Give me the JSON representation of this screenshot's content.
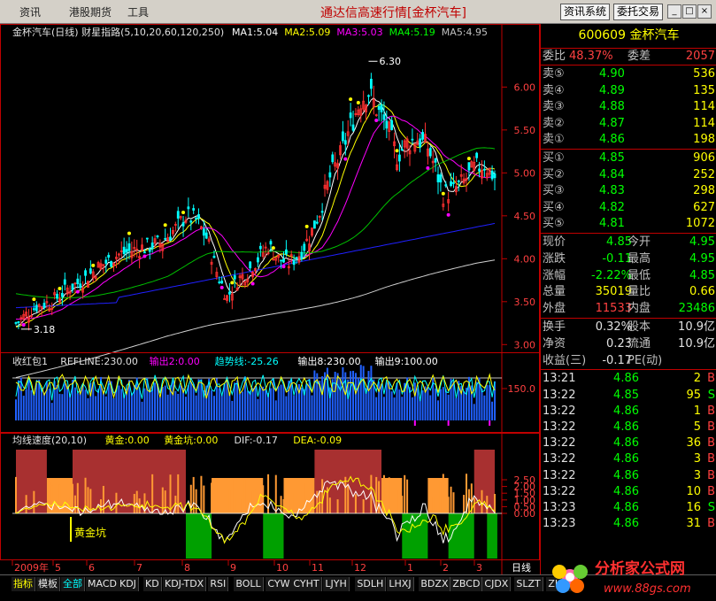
{
  "window": {
    "menus": [
      "资讯",
      "港股期货",
      "工具"
    ],
    "app_title": "通达信高速行情[金杯汽车]",
    "buttons": [
      "资讯系统",
      "委托交易"
    ],
    "win_controls": [
      "_",
      "□",
      "×"
    ]
  },
  "main_chart": {
    "header_prefix": "金杯汽车(日线) 财星指路(5,10,20,60,120,250)",
    "ma": [
      {
        "label": "MA1:5.04",
        "color": "#ffffff"
      },
      {
        "label": "MA2:5.09",
        "color": "#ffff00"
      },
      {
        "label": "MA3:5.03",
        "color": "#ff00ff"
      },
      {
        "label": "MA4:5.19",
        "color": "#00ff00"
      },
      {
        "label": "MA5:4.95",
        "color": "#c0c0c0"
      }
    ],
    "y_ticks": [
      "6.00",
      "5.50",
      "5.00",
      "4.50",
      "4.00",
      "3.50",
      "3.00"
    ],
    "high_label": "6.30",
    "low_label": "3.18"
  },
  "indicator1": {
    "items": [
      {
        "text": "收红包1",
        "color": "#e0e0e0"
      },
      {
        "text": "REFLINE:230.00",
        "color": "#e0e0e0"
      },
      {
        "text": "输出2:0.00",
        "color": "#ff00ff"
      },
      {
        "text": "趋势线:-25.26",
        "color": "#00ffff"
      },
      {
        "text": "输出8:230.00",
        "color": "#ffffff"
      },
      {
        "text": "输出9:100.00",
        "color": "#ffffff"
      }
    ],
    "y_tick": "150.0"
  },
  "indicator2": {
    "items": [
      {
        "text": "均线速度(20,10)",
        "color": "#e0e0e0"
      },
      {
        "text": "黄金:0.00",
        "color": "#ffff00"
      },
      {
        "text": "黄金坑:0.00",
        "color": "#ffff00"
      },
      {
        "text": "DIF:-0.17",
        "color": "#e0e0e0"
      },
      {
        "text": "DEA:-0.09",
        "color": "#ffff00"
      }
    ],
    "y_ticks": [
      "2.50",
      "2.00",
      "1.50",
      "1.00",
      "0.50",
      "0.00"
    ],
    "pit_label": "黄金坑"
  },
  "time_axis": {
    "labels": [
      "2009年",
      "5",
      "6",
      "7",
      "8",
      "9",
      "10",
      "11",
      "12",
      "1",
      "2",
      "3"
    ],
    "period": "日线"
  },
  "quote": {
    "title": "600609 金杯汽车",
    "wei_bi_label": "委比",
    "wei_bi": "48.37%",
    "wei_cha_label": "委差",
    "wei_cha": "2057",
    "sell": [
      {
        "label": "卖⑤",
        "price": "4.90",
        "vol": "536"
      },
      {
        "label": "卖④",
        "price": "4.89",
        "vol": "135"
      },
      {
        "label": "卖③",
        "price": "4.88",
        "vol": "114"
      },
      {
        "label": "卖②",
        "price": "4.87",
        "vol": "114"
      },
      {
        "label": "卖①",
        "price": "4.86",
        "vol": "198"
      }
    ],
    "buy": [
      {
        "label": "买①",
        "price": "4.85",
        "vol": "906"
      },
      {
        "label": "买②",
        "price": "4.84",
        "vol": "252"
      },
      {
        "label": "买③",
        "price": "4.83",
        "vol": "298"
      },
      {
        "label": "买④",
        "price": "4.82",
        "vol": "627"
      },
      {
        "label": "买⑤",
        "price": "4.81",
        "vol": "1072"
      }
    ],
    "stats": [
      {
        "l1": "现价",
        "v1": "4.85",
        "c1": "#00ff00",
        "l2": "今开",
        "v2": "4.95",
        "c2": "#00ff00"
      },
      {
        "l1": "涨跌",
        "v1": "-0.11",
        "c1": "#00ff00",
        "l2": "最高",
        "v2": "4.95",
        "c2": "#00ff00"
      },
      {
        "l1": "涨幅",
        "v1": "-2.22%",
        "c1": "#00ff00",
        "l2": "最低",
        "v2": "4.85",
        "c2": "#00ff00"
      },
      {
        "l1": "总量",
        "v1": "35019",
        "c1": "#ffff00",
        "l2": "量比",
        "v2": "0.66",
        "c2": "#ffff00"
      },
      {
        "l1": "外盘",
        "v1": "11533",
        "c1": "#ff4040",
        "l2": "内盘",
        "v2": "23486",
        "c2": "#00ff00"
      }
    ],
    "stats2": [
      {
        "l1": "换手",
        "v1": "0.32%",
        "l2": "股本",
        "v2": "10.9亿"
      },
      {
        "l1": "净资",
        "v1": "0.23",
        "l2": "流通",
        "v2": "10.9亿"
      },
      {
        "l1": "收益(三)",
        "v1": "-0.17",
        "l2": "PE(动)",
        "v2": ""
      }
    ],
    "ticks": [
      {
        "time": "13:21",
        "price": "4.86",
        "vol": "2",
        "side": "B"
      },
      {
        "time": "13:22",
        "price": "4.85",
        "vol": "95",
        "side": "S"
      },
      {
        "time": "13:22",
        "price": "4.86",
        "vol": "1",
        "side": "B"
      },
      {
        "time": "13:22",
        "price": "4.86",
        "vol": "5",
        "side": "B"
      },
      {
        "time": "13:22",
        "price": "4.86",
        "vol": "36",
        "side": "B"
      },
      {
        "time": "13:22",
        "price": "4.86",
        "vol": "3",
        "side": "B"
      },
      {
        "time": "13:22",
        "price": "4.86",
        "vol": "3",
        "side": "B"
      },
      {
        "time": "13:22",
        "price": "4.86",
        "vol": "10",
        "side": "B"
      },
      {
        "time": "13:23",
        "price": "4.86",
        "vol": "16",
        "side": "S"
      },
      {
        "time": "13:23",
        "price": "4.86",
        "vol": "31",
        "side": "B"
      }
    ]
  },
  "bottom_tabs": [
    "指标",
    "模板",
    "全部",
    "MACD",
    "KDJ",
    "KD",
    "KDJ-TDX",
    "RSI",
    "BOLL",
    "CYW",
    "CYHT",
    "LJYH",
    "SDLH",
    "LHXJ",
    "BDZX",
    "ZBCD",
    "CJDX",
    "SLZT",
    "ZLMM"
  ],
  "watermark": {
    "line1": "分析家公式网",
    "line2": "www.88gs.com"
  },
  "colors": {
    "up": "#ff3030",
    "down": "#00ffff",
    "ma5": "#ffffff",
    "ma10": "#ffff00",
    "ma20": "#ff00ff",
    "ma60": "#00c000",
    "ma120": "#d0d0d0",
    "ma250": "#2020ff"
  }
}
